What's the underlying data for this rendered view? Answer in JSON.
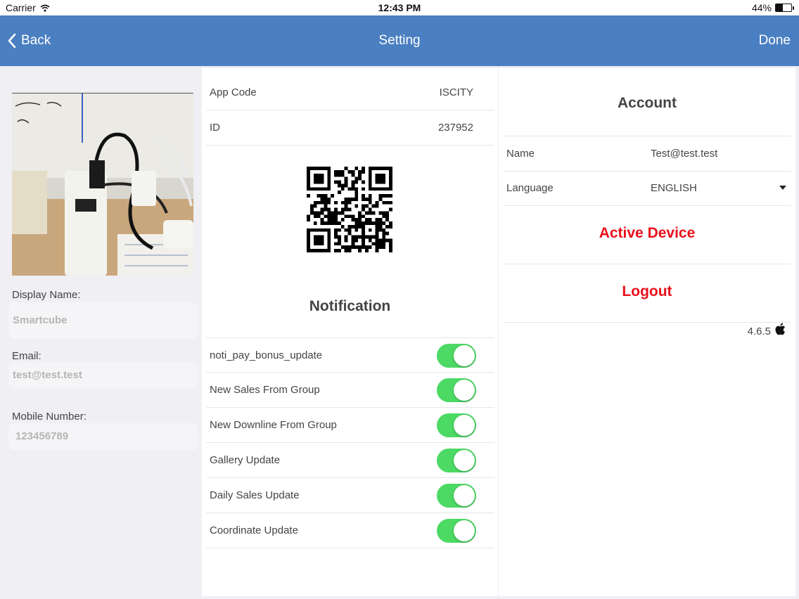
{
  "status_bar": {
    "carrier": "Carrier",
    "time": "12:43 PM",
    "battery": "44%",
    "battery_level": 0.44
  },
  "nav": {
    "back_label": "Back",
    "title": "Setting",
    "done_label": "Done"
  },
  "profile": {
    "display_name_label": "Display Name:",
    "display_name_value": "Smartcube",
    "email_label": "Email:",
    "email_value": "test@test.test",
    "mobile_label": "Mobile Number:",
    "mobile_value": "123456789"
  },
  "info": {
    "app_code_label": "App Code",
    "app_code_value": "ISCITY",
    "id_label": "ID",
    "id_value": "237952"
  },
  "notification": {
    "title": "Notification",
    "items": [
      {
        "label": "noti_pay_bonus_update",
        "on": true
      },
      {
        "label": "New Sales From Group",
        "on": true
      },
      {
        "label": "New Downline From Group",
        "on": true
      },
      {
        "label": "Gallery Update",
        "on": true
      },
      {
        "label": "Daily Sales Update",
        "on": true
      },
      {
        "label": "Coordinate Update",
        "on": true
      }
    ]
  },
  "account": {
    "title": "Account",
    "name_label": "Name",
    "name_value": "Test@test.test",
    "language_label": "Language",
    "language_value": "ENGLISH",
    "active_device_label": "Active Device",
    "logout_label": "Logout",
    "version": "4.6.5"
  },
  "colors": {
    "nav_bar": "#4a7fc1",
    "toggle_on": "#4cd964",
    "danger": "#e8101a"
  },
  "icons": [
    "wifi-icon",
    "chevron-left-icon",
    "qr-code-icon",
    "dropdown-arrow-icon",
    "apple-icon"
  ]
}
